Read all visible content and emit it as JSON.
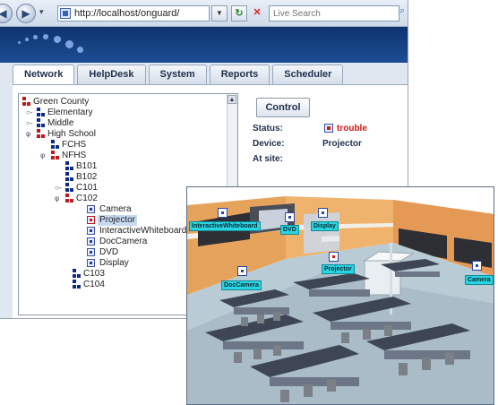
{
  "browser": {
    "url": "http://localhost/onguard/",
    "search_placeholder": "Live Search"
  },
  "tabs": [
    "Network",
    "HelpDesk",
    "System",
    "Reports",
    "Scheduler"
  ],
  "tree": {
    "nodes": [
      {
        "label": "Green County"
      },
      {
        "label": "Elementary"
      },
      {
        "label": "Middle"
      },
      {
        "label": "High School"
      },
      {
        "label": "FCHS"
      },
      {
        "label": "NFHS"
      },
      {
        "label": "B101"
      },
      {
        "label": "B102"
      },
      {
        "label": "C101"
      },
      {
        "label": "C102"
      },
      {
        "label": "Camera"
      },
      {
        "label": "Projector"
      },
      {
        "label": "InteractiveWhiteboard"
      },
      {
        "label": "DocCamera"
      },
      {
        "label": "DVD"
      },
      {
        "label": "Display"
      },
      {
        "label": "C103"
      },
      {
        "label": "C104"
      }
    ]
  },
  "details": {
    "control_label": "Control",
    "status_label": "Status:",
    "status_value": "trouble",
    "device_label": "Device:",
    "device_value": "Projector",
    "site_label": "At site:"
  },
  "room": {
    "labels": {
      "whiteboard": "InteractiveWhiteboard",
      "dvd": "DVD",
      "display": "Display",
      "projector": "Projector",
      "doccamera": "DocCamera",
      "camera": "Camera"
    }
  },
  "colors": {
    "header_blue": "#1c4d93",
    "trouble_red": "#d01818",
    "label_cyan": "#2ad4e0",
    "tree_node_blue": "#0d2a86"
  }
}
